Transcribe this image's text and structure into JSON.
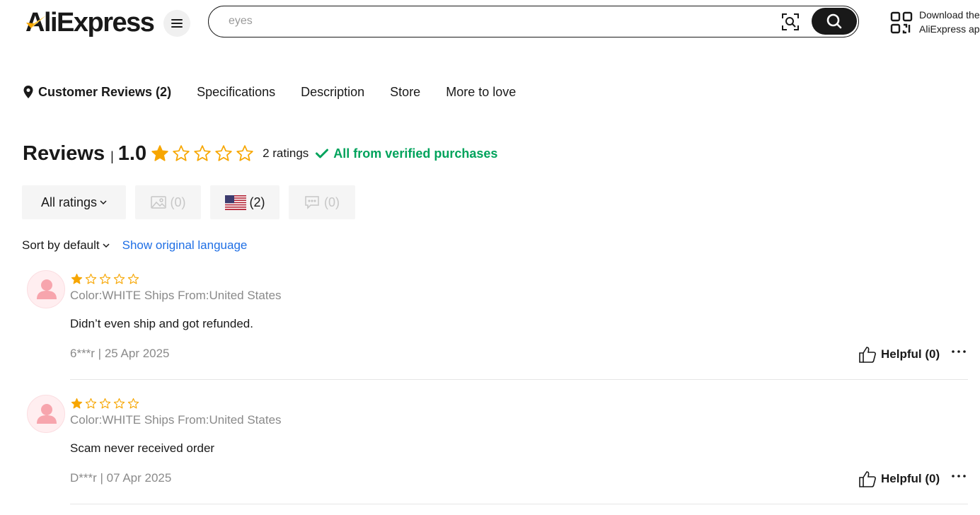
{
  "header": {
    "logo_text": "AliExpress",
    "search": {
      "value": "",
      "placeholder": "eyes"
    },
    "download_text_line1": "Download the",
    "download_text_line2": "AliExpress app"
  },
  "tabs": [
    {
      "label": "Customer Reviews (2)",
      "active": true
    },
    {
      "label": "Specifications",
      "active": false
    },
    {
      "label": "Description",
      "active": false
    },
    {
      "label": "Store",
      "active": false
    },
    {
      "label": "More to love",
      "active": false
    }
  ],
  "reviews_summary": {
    "title": "Reviews",
    "separator": "|",
    "score": "1.0",
    "stars_filled": 1,
    "stars_total": 5,
    "ratings_count": "2 ratings",
    "verified_text": "All from verified purchases"
  },
  "filters": {
    "all_ratings": "All ratings",
    "images": "(0)",
    "country": "(2)",
    "comments": "(0)"
  },
  "sort": {
    "label": "Sort by default",
    "show_original": "Show original language"
  },
  "reviews": [
    {
      "stars_filled": 1,
      "meta": "Color:WHITE Ships From:United States",
      "text": "Didn’t even ship and got refunded.",
      "author_date": "6***r | 25 Apr 2025",
      "helpful": "Helpful (0)"
    },
    {
      "stars_filled": 1,
      "meta": "Color:WHITE Ships From:United States",
      "text": "Scam never received order",
      "author_date": "D***r | 07 Apr 2025",
      "helpful": "Helpful (0)"
    }
  ],
  "colors": {
    "star": "#f7a600",
    "verified": "#00a35c",
    "link": "#1f6fe5",
    "logo_swoosh": "#f7a600"
  }
}
